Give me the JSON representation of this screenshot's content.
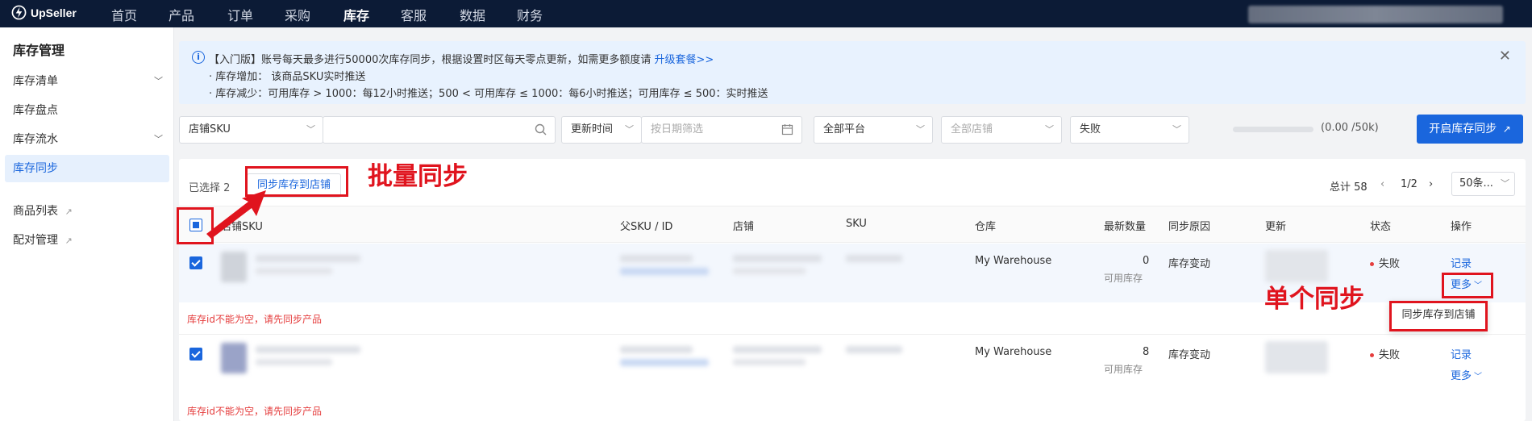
{
  "app": {
    "logo_text": "UpSeller"
  },
  "nav": {
    "items": [
      {
        "label": "首页"
      },
      {
        "label": "产品"
      },
      {
        "label": "订单"
      },
      {
        "label": "采购"
      },
      {
        "label": "库存"
      },
      {
        "label": "客服"
      },
      {
        "label": "数据"
      },
      {
        "label": "财务"
      }
    ],
    "active": "库存"
  },
  "sidebar": {
    "title": "库存管理",
    "items": [
      {
        "label": "库存清单"
      },
      {
        "label": "库存盘点"
      },
      {
        "label": "库存流水"
      },
      {
        "label": "库存同步"
      },
      {
        "label": "商品列表"
      },
      {
        "label": "配对管理"
      }
    ]
  },
  "notice": {
    "line1_text": "【入门版】账号每天最多进行50000次库存同步，根据设置时区每天零点更新，如需更多额度请 ",
    "line1_link": "升级套餐>>",
    "line2": "· 库存增加：  该商品SKU实时推送",
    "line3": "· 库存减少：可用库存 > 1000：每12小时推送；500 <  可用库存 ≤ 1000：每6小时推送；可用库存 ≤ 500：实时推送"
  },
  "filters": {
    "sku_type": "店铺SKU",
    "time_type": "更新时间",
    "date_placeholder": "按日期筛选",
    "platform": "全部平台",
    "shop_placeholder": "全部店铺",
    "status": "失败",
    "progress_text": "(0.00 /50k)",
    "start_sync_button": "开启库存同步"
  },
  "toolbar": {
    "selected_text": "已选择 2",
    "sync_button": "同步库存到店铺",
    "total_text": "总计 58",
    "page": "1/2",
    "page_size": "50条..."
  },
  "table": {
    "headers": {
      "shop_sku": "店铺SKU",
      "parent_sku": "父SKU / ID",
      "shop": "店铺",
      "sku": "SKU",
      "warehouse": "仓库",
      "latest_qty": "最新数量",
      "reason": "同步原因",
      "updated": "更新",
      "status": "状态",
      "actions": "操作"
    },
    "rows": [
      {
        "warehouse": "My Warehouse",
        "qty": "0",
        "qty_label": "可用库存",
        "reason": "库存变动",
        "status": "失败",
        "record": "记录",
        "more": "更多",
        "error": "库存id不能为空，请先同步产品"
      },
      {
        "warehouse": "My Warehouse",
        "qty": "8",
        "qty_label": "可用库存",
        "reason": "库存变动",
        "status": "失败",
        "record": "记录",
        "more": "更多",
        "error": "库存id不能为空，请先同步产品"
      }
    ]
  },
  "dropdown": {
    "item": "同步库存到店铺"
  },
  "annotations": {
    "batch_label": "批量同步",
    "single_label": "单个同步",
    "color": "#e0141e"
  },
  "colors": {
    "primary": "#1a66dd",
    "nav_bg": "#0c1b36",
    "error": "#e53e3e"
  }
}
